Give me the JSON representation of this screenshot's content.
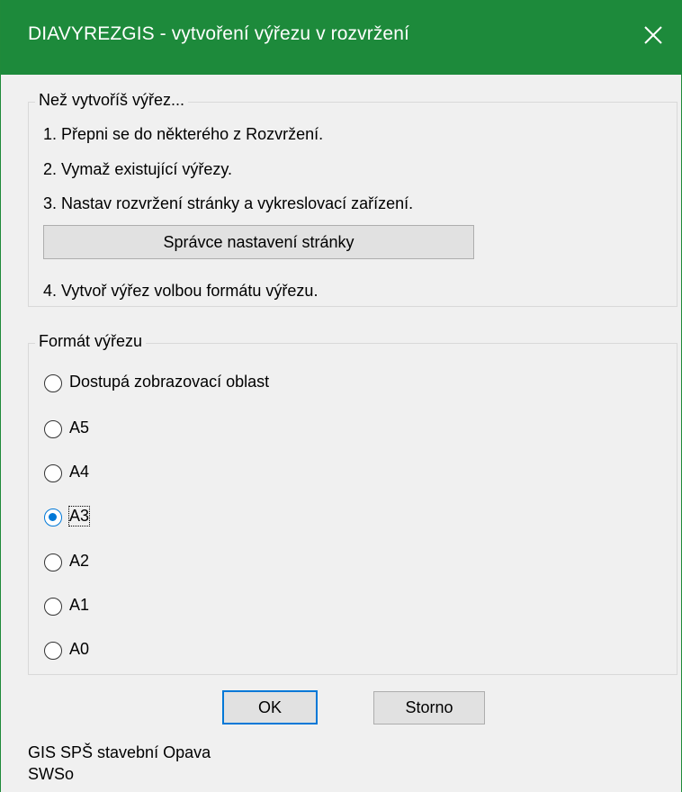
{
  "window": {
    "title": "DIAVYREZGIS - vytvoření výřezu v rozvržení",
    "close_icon": "close-icon"
  },
  "instructions": {
    "legend": "Než vytvoříš výřez...",
    "step1": "1. Přepni se do některého z Rozvržení.",
    "step2": "2. Vymaž existující výřezy.",
    "step3": "3. Nastav rozvržení stránky a vykreslovací zařízení.",
    "page_setup_button": "Správce nastavení stránky",
    "step4": "4. Vytvoř výřez volbou formátu výřezu."
  },
  "format": {
    "legend": "Formát výřezu",
    "options": [
      {
        "label": "Dostupá zobrazovací oblast",
        "checked": false
      },
      {
        "label": "A5",
        "checked": false
      },
      {
        "label": "A4",
        "checked": false
      },
      {
        "label": "A3",
        "checked": true
      },
      {
        "label": "A2",
        "checked": false
      },
      {
        "label": "A1",
        "checked": false
      },
      {
        "label": "A0",
        "checked": false
      }
    ]
  },
  "buttons": {
    "ok": "OK",
    "cancel": "Storno"
  },
  "footer": {
    "line1": "GIS SPŠ stavební Opava",
    "line2": "SWSo"
  },
  "colors": {
    "titlebar": "#1d8a3b",
    "accent": "#0078d7"
  }
}
